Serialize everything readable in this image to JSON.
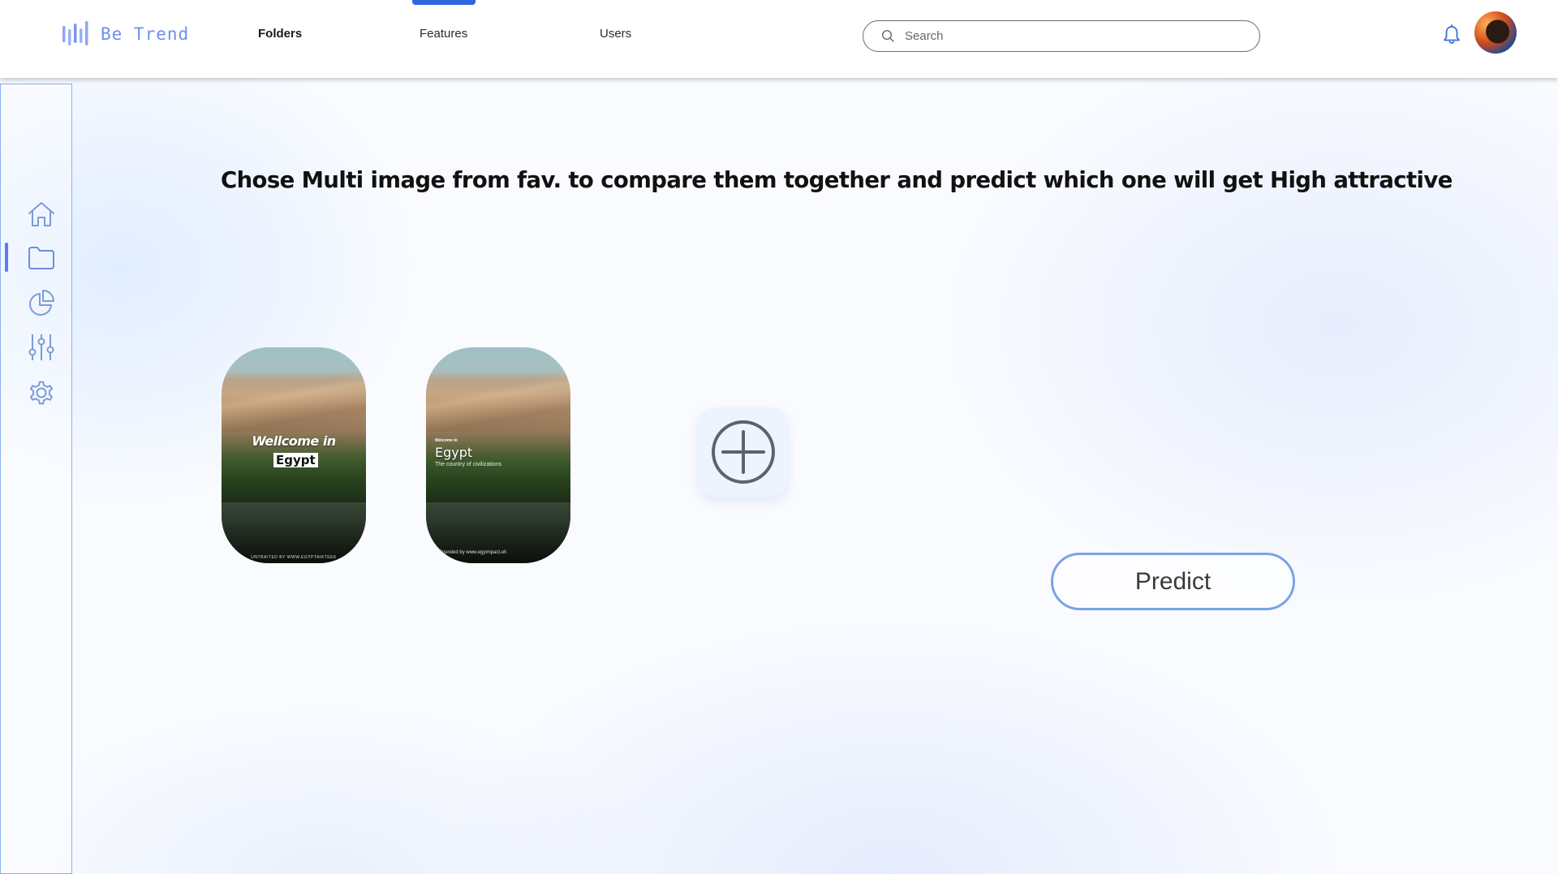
{
  "brand": {
    "name": "Be Trend"
  },
  "nav": {
    "items": [
      {
        "label": "Folders",
        "active": true
      },
      {
        "label": "Features",
        "active": false
      },
      {
        "label": "Users",
        "active": false
      }
    ]
  },
  "search": {
    "placeholder": "Search",
    "value": ""
  },
  "header_icons": [
    "bell-icon",
    "user-avatar"
  ],
  "sidebar": {
    "items": [
      {
        "icon": "home-icon",
        "active": false
      },
      {
        "icon": "folder-icon",
        "active": true
      },
      {
        "icon": "pie-chart-icon",
        "active": false
      },
      {
        "icon": "sliders-icon",
        "active": false
      },
      {
        "icon": "gear-icon",
        "active": false
      }
    ]
  },
  "main": {
    "headline": "Chose Multi image from fav. to compare them together and predict which one will get High attractive",
    "images": [
      {
        "title_line1": "Wellcome in",
        "title_line2": "Egypt",
        "footer": "UNTRAITED BY WWW.EGYPTAIKTEEK"
      },
      {
        "small": "Welcome to",
        "title": "Egypt",
        "subtitle": "The country of civilizations",
        "footer": "Founded by www.egyimpact.eh"
      }
    ],
    "add_icon": "plus-circle-icon",
    "predict_label": "Predict"
  },
  "colors": {
    "accent": "#2f66e0",
    "brand": "#6f8ff0",
    "sidebar_border": "#8cb1ee",
    "predict_border": "#7aa3e6"
  }
}
